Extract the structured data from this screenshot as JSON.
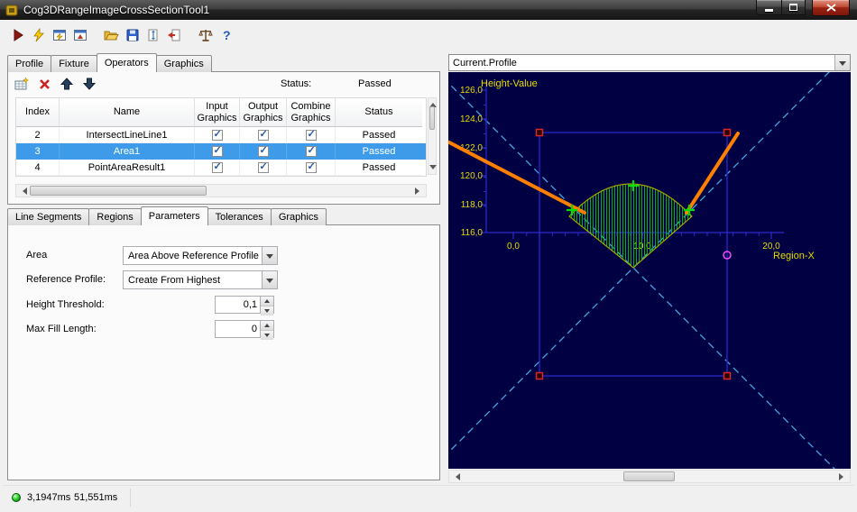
{
  "window": {
    "title": "Cog3DRangeImageCrossSectionTool1",
    "statusbar": {
      "led_color": "#2bbf2b",
      "time1": "3,1947ms",
      "time2": "51,551ms"
    }
  },
  "toolbar": {
    "icons": [
      "run",
      "run-electric",
      "electric-tool-window",
      "tool-window",
      "open-file",
      "save-file",
      "update-results",
      "import-results",
      "benchmark",
      "help"
    ]
  },
  "tabs": {
    "items": [
      "Profile",
      "Fixture",
      "Operators",
      "Graphics"
    ],
    "active": "Operators"
  },
  "operators": {
    "status_label": "Status:",
    "status_value": "Passed",
    "toolbar_icons": [
      "add-operator",
      "delete-operator",
      "move-up",
      "move-down"
    ],
    "table": {
      "columns": [
        "Index",
        "Name",
        "Input Graphics",
        "Output Graphics",
        "Combine Graphics",
        "Status"
      ],
      "rows": [
        {
          "index": "2",
          "name": "IntersectLineLine1",
          "input_graphics": true,
          "output_graphics": true,
          "combine_graphics": true,
          "status": "Passed",
          "selected": false
        },
        {
          "index": "3",
          "name": "Area1",
          "input_graphics": true,
          "output_graphics": true,
          "combine_graphics": true,
          "status": "Passed",
          "selected": true
        },
        {
          "index": "4",
          "name": "PointAreaResult1",
          "input_graphics": true,
          "output_graphics": true,
          "combine_graphics": true,
          "status": "Passed",
          "selected": false
        }
      ]
    }
  },
  "subtabs": {
    "items": [
      "Line Segments",
      "Regions",
      "Parameters",
      "Tolerances",
      "Graphics"
    ],
    "active": "Parameters"
  },
  "parameters": {
    "area_label": "Area",
    "area_value": "Area Above Reference Profile",
    "reference_profile_label": "Reference Profile:",
    "reference_profile_value": "Create From Highest",
    "height_threshold_label": "Height Threshold:",
    "height_threshold_value": "0,1",
    "max_fill_length_label": "Max Fill Length:",
    "max_fill_length_value": "0"
  },
  "profile_view": {
    "selector_value": "Current.Profile",
    "chart_data": {
      "type": "line",
      "title": "Current.Profile",
      "xlabel": "Region-X",
      "ylabel": "Height-Value",
      "xlim": [
        -3.5,
        21.5
      ],
      "ylim": [
        116,
        126
      ],
      "x_ticks": [
        "0,0",
        "10,0",
        "20,0"
      ],
      "x_tick_values": [
        0,
        10,
        20
      ],
      "y_ticks": [
        "126,0",
        "124,0",
        "122,0",
        "120,0",
        "118,0",
        "116,0"
      ],
      "y_tick_values": [
        126,
        124,
        122,
        120,
        118,
        116
      ],
      "grid": false,
      "background": "#000042",
      "axis_color": "#2a2acc",
      "tick_label_color": "#e8dc00",
      "series": [
        {
          "name": "profile-left-segment",
          "type": "line",
          "color": "#ff7f00",
          "points": [
            [
              -5.0,
              122.3
            ],
            [
              5.5,
              117.4
            ]
          ]
        },
        {
          "name": "profile-right-segment",
          "type": "line",
          "color": "#ff7f00",
          "points": [
            [
              13.4,
              117.4
            ],
            [
              17.4,
              123.0
            ]
          ]
        },
        {
          "name": "area-above-reference-profile",
          "type": "filled-region",
          "fill_style": "vertical-hatch",
          "color": "#00b400",
          "outline_color": "#a8a800",
          "base_points": [
            [
              4.3,
              117.1
            ],
            [
              13.8,
              117.1
            ]
          ],
          "arc_peak": [
            9.3,
            119.4
          ],
          "apex": [
            9.3,
            113.5
          ]
        }
      ],
      "markers": [
        {
          "name": "area-extent-crosses",
          "type": "cross",
          "color": "#00e000",
          "points": [
            [
              4.5,
              117.6
            ],
            [
              9.3,
              119.3
            ],
            [
              13.6,
              117.6
            ]
          ]
        },
        {
          "name": "region-corner-handles",
          "type": "square",
          "color": "#d42a2a",
          "points": [
            [
              2.0,
              123.0
            ],
            [
              16.6,
              123.0
            ],
            [
              2.0,
              105.9
            ],
            [
              16.6,
              105.9
            ]
          ]
        },
        {
          "name": "region-rotation-handle",
          "type": "circle",
          "color": "#ff45ff",
          "points": [
            [
              16.6,
              114.4
            ]
          ]
        }
      ],
      "region_box": {
        "x_range": [
          2.0,
          16.6
        ],
        "y_range": [
          105.9,
          123.0
        ],
        "color": "#2222b8"
      },
      "crosshair_diagonals": {
        "style": "dashed",
        "color": "#3fa9e0"
      }
    }
  }
}
